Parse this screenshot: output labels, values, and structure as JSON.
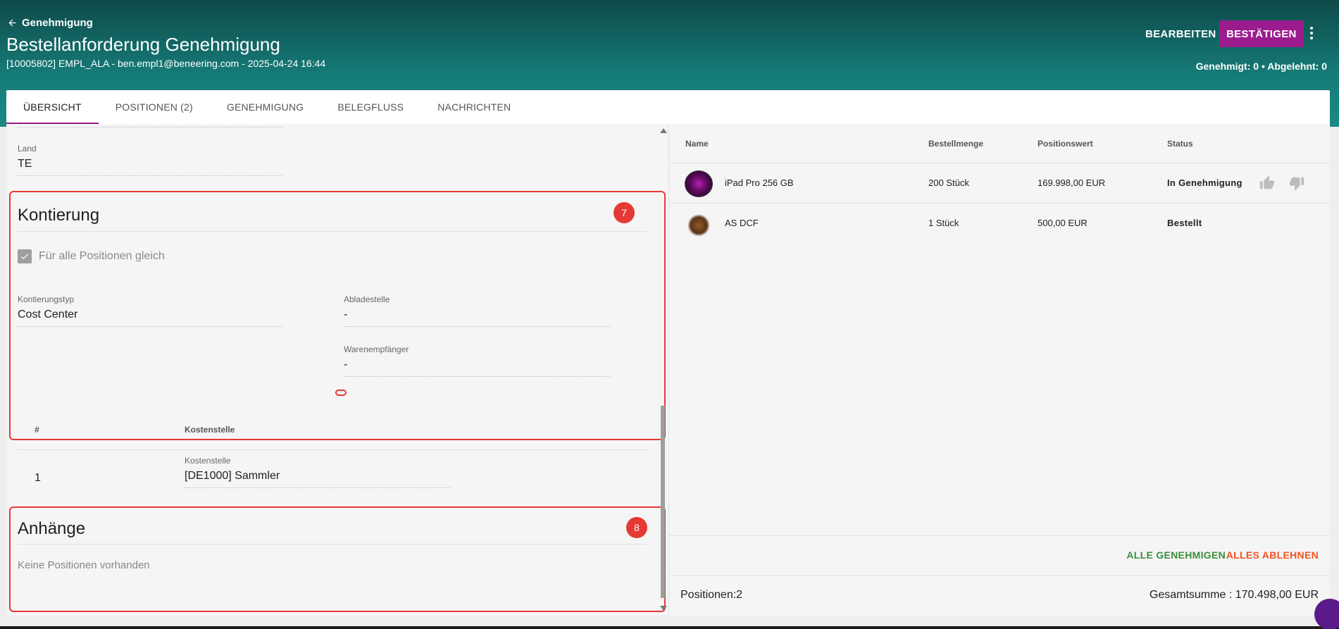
{
  "header": {
    "back_label": "Genehmigung",
    "title": "Bestellanforderung Genehmigung",
    "subtitle": "[10005802] EMPL_ALA - ben.empl1@beneering.com - 2025-04-24 16:44",
    "edit_label": "BEARBEITEN",
    "confirm_label": "BESTÄTIGEN",
    "approval_count": "Genehmigt: 0 • Abgelehnt: 0"
  },
  "tabs": [
    {
      "label": "ÜBERSICHT",
      "active": true
    },
    {
      "label": "POSITIONEN (2)",
      "active": false
    },
    {
      "label": "GENEHMIGUNG",
      "active": false
    },
    {
      "label": "BELEGFLUSS",
      "active": false
    },
    {
      "label": "NACHRICHTEN",
      "active": false
    }
  ],
  "left": {
    "country": {
      "label": "Land",
      "value": "TE"
    },
    "kontierung": {
      "title": "Kontierung",
      "badge": "7",
      "same_for_all_label": "Für alle Positionen gleich",
      "same_for_all_checked": true,
      "kontierungstyp": {
        "label": "Kontierungstyp",
        "value": "Cost Center"
      },
      "abladestelle": {
        "label": "Abladestelle",
        "value": "-"
      },
      "warenempfaenger": {
        "label": "Warenempfänger",
        "value": "-"
      },
      "table_headers": {
        "num": "#",
        "kostenstelle": "Kostenstelle"
      },
      "rows": [
        {
          "num": "1",
          "kostenstelle_label": "Kostenstelle",
          "kostenstelle_value": "[DE1000] Sammler"
        }
      ]
    },
    "anhaenge": {
      "title": "Anhänge",
      "badge": "8",
      "empty_text": "Keine Positionen vorhanden"
    }
  },
  "right": {
    "headers": {
      "name": "Name",
      "qty": "Bestellmenge",
      "value": "Positionswert",
      "status": "Status"
    },
    "items": [
      {
        "name": "iPad Pro 256 GB",
        "qty": "200 Stück",
        "value": "169.998,00 EUR",
        "status": "In Genehmigung",
        "icon": "ipad-thumbnail"
      },
      {
        "name": "AS DCF",
        "qty": "1 Stück",
        "value": "500,00 EUR",
        "status": "Bestellt",
        "icon": "bird-thumbnail"
      }
    ],
    "approve_all_label": "ALLE GENEHMIGEN",
    "reject_all_label": "ALLES ABLEHNEN",
    "positions_label": "Positionen:2",
    "total_label": "Gesamtsumme : 170.498,00 EUR"
  },
  "colors": {
    "accent": "#9c1c8e",
    "header_dark": "#0e4a4a",
    "header_light": "#1b8a84",
    "approve": "#388e3c",
    "reject": "#f4511e",
    "annotation": "#e53935"
  }
}
